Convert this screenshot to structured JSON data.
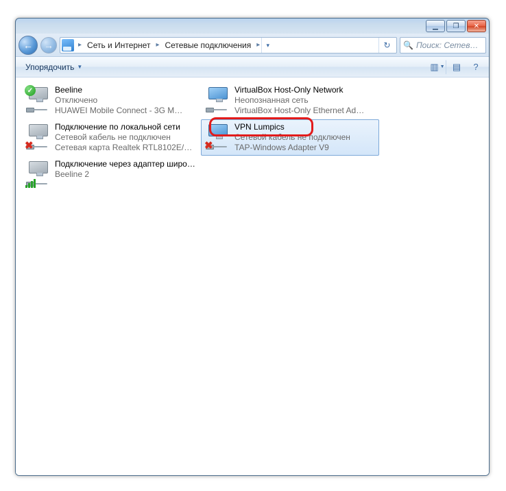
{
  "titlebar": {
    "min_icon": "▁",
    "max_icon": "❐",
    "close_icon": "✕"
  },
  "nav": {
    "back_glyph": "←",
    "fwd_glyph": "→",
    "crumb1": "Сеть и Интернет",
    "crumb2": "Сетевые подключения",
    "arrow": "▸",
    "refresh_glyph": "↻",
    "search_placeholder": "Поиск: Сетев…"
  },
  "toolbar": {
    "organize": "Упорядочить",
    "view_glyph": "▥",
    "pane_glyph": "▤",
    "help_glyph": "?"
  },
  "items": [
    {
      "name": "Beeline",
      "status": "Отключено",
      "device": "HUAWEI Mobile Connect - 3G M…",
      "icon": "grey",
      "overlay": "check"
    },
    {
      "name": "VirtualBox Host-Only Network",
      "status": "Неопознанная сеть",
      "device": "VirtualBox Host-Only Ethernet Ad…",
      "icon": "color",
      "overlay": "none"
    },
    {
      "name": "Подключение по локальной сети",
      "status": "Сетевой кабель не подключен",
      "device": "Сетевая карта Realtek RTL8102E/…",
      "icon": "grey",
      "overlay": "x"
    },
    {
      "name": "VPN Lumpics",
      "status": "Сетевой кабель не подключен",
      "device": "TAP-Windows Adapter V9",
      "icon": "color",
      "overlay": "x",
      "selected": true
    },
    {
      "name": "Подключение через адаптер широкополосной мобильной с…",
      "status": "Beeline  2",
      "device": "",
      "icon": "grey",
      "overlay": "bars"
    }
  ]
}
